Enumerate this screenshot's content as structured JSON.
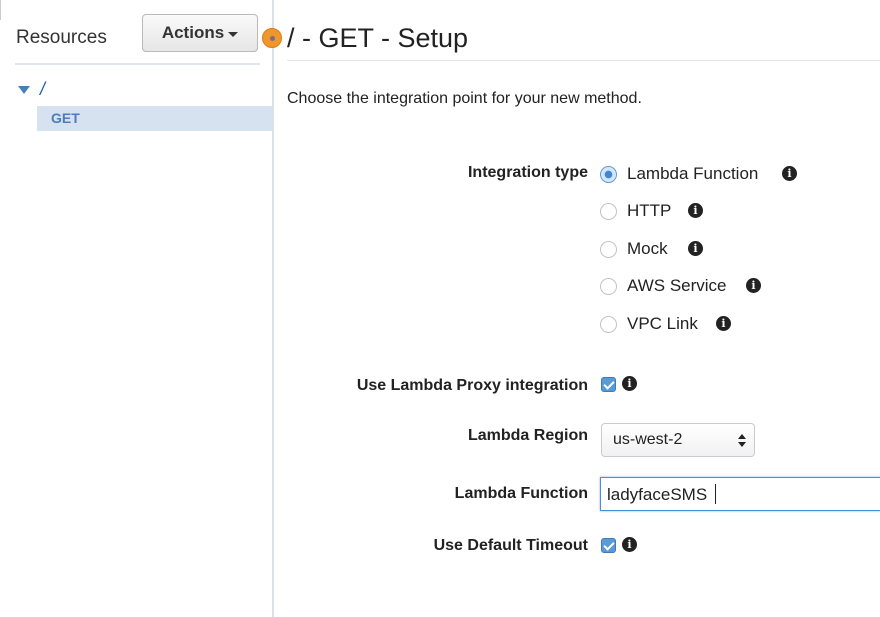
{
  "sidebar": {
    "title": "Resources",
    "actions_label": "Actions",
    "tree": {
      "root": "/",
      "method": "GET"
    }
  },
  "main": {
    "title": "/ - GET - Setup",
    "subtitle": "Choose the integration point for your new method.",
    "integration_type": {
      "label": "Integration type",
      "options": [
        {
          "label": "Lambda Function",
          "selected": true
        },
        {
          "label": "HTTP",
          "selected": false
        },
        {
          "label": "Mock",
          "selected": false
        },
        {
          "label": "AWS Service",
          "selected": false
        },
        {
          "label": "VPC Link",
          "selected": false
        }
      ]
    },
    "proxy": {
      "label": "Use Lambda Proxy integration",
      "checked": true
    },
    "region": {
      "label": "Lambda Region",
      "value": "us-west-2"
    },
    "function": {
      "label": "Lambda Function",
      "value": "ladyfaceSMS"
    },
    "timeout": {
      "label": "Use Default Timeout",
      "checked": true
    }
  },
  "icons": {
    "info": "info-icon",
    "info_glyph": "i"
  },
  "colors": {
    "accent": "#3f86d6",
    "orange": "#f0962e",
    "tree_selected_bg": "#d6e2f0"
  }
}
